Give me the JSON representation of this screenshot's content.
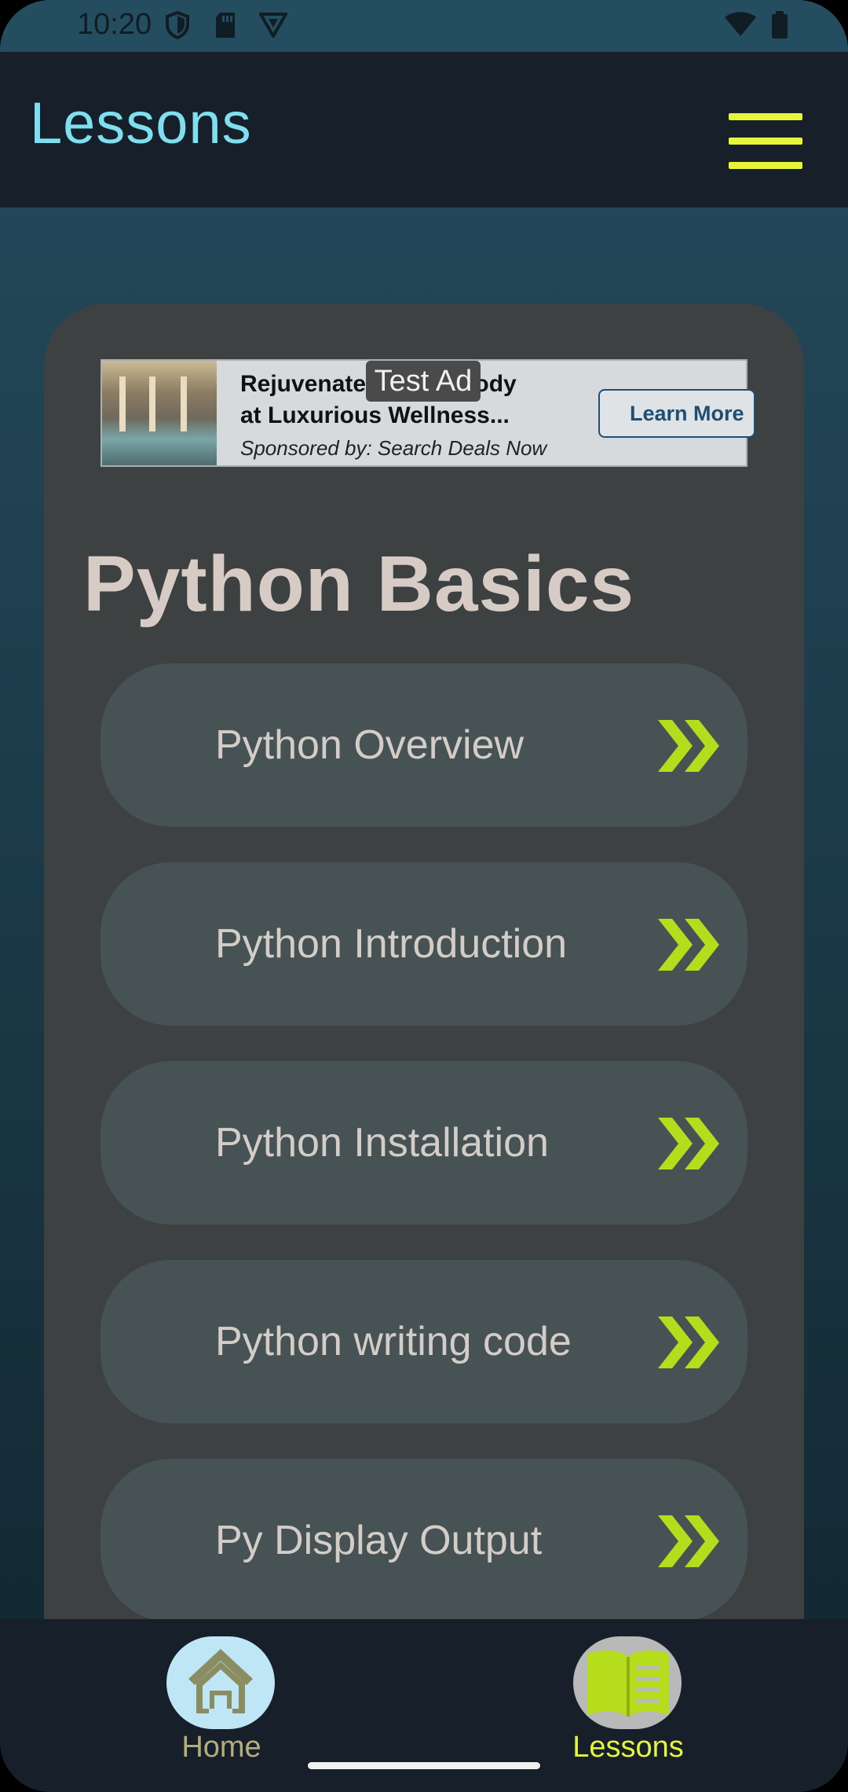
{
  "status_bar": {
    "time": "10:20",
    "icons": [
      "shield-icon",
      "sd-card-icon",
      "vpn-icon",
      "wifi-icon",
      "battery-icon"
    ]
  },
  "header": {
    "title": "Lessons",
    "menu_icon": "hamburger-menu-icon",
    "title_color": "#7ee0ef",
    "accent_color": "#e5f53a"
  },
  "ad": {
    "badge": "Test Ad",
    "headline_line1": "Rejuvenate Mind & Body",
    "headline_line2": "at Luxurious Wellness...",
    "sponsor": "Sponsored by: Search Deals Now",
    "cta": "Learn More"
  },
  "main": {
    "section_title": "Python Basics",
    "lessons": [
      {
        "label": "Python Overview",
        "icon": "double-chevron-right-icon"
      },
      {
        "label": "Python Introduction",
        "icon": "double-chevron-right-icon"
      },
      {
        "label": "Python Installation",
        "icon": "double-chevron-right-icon"
      },
      {
        "label": "Python writing code",
        "icon": "double-chevron-right-icon"
      },
      {
        "label": "Py Display Output",
        "icon": "double-chevron-right-icon"
      }
    ]
  },
  "bottom_nav": {
    "items": [
      {
        "label": "Home",
        "icon": "home-icon",
        "selected": false
      },
      {
        "label": "Lessons",
        "icon": "book-icon",
        "selected": true
      }
    ]
  }
}
